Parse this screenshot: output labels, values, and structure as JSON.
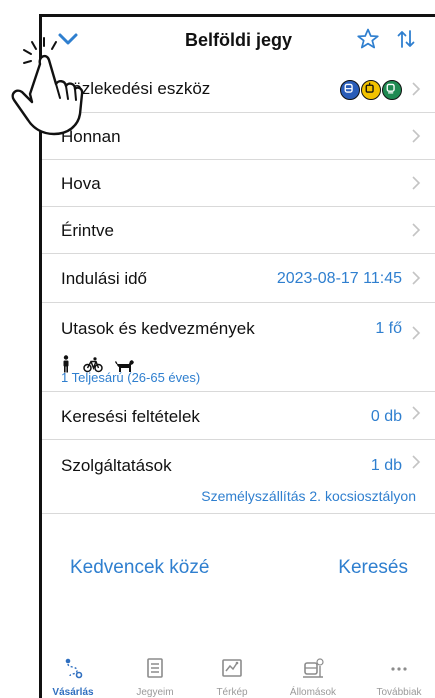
{
  "header": {
    "title": "Belföldi jegy"
  },
  "rows": {
    "transport": {
      "label": "Közlekedési eszköz",
      "icons": [
        "bus-icon",
        "tram-icon",
        "train-icon"
      ]
    },
    "from": {
      "label": "Honnan"
    },
    "to": {
      "label": "Hova"
    },
    "via": {
      "label": "Érintve"
    },
    "departure": {
      "label": "Indulási idő",
      "value": "2023-08-17 11:45"
    },
    "passengers": {
      "label": "Utasok és kedvezmények",
      "value": "1 fő",
      "icons": [
        "person-icon",
        "bicycle-icon",
        "dog-icon"
      ],
      "detail": "1 Teljesárú (26-65 éves)"
    },
    "criteria": {
      "label": "Keresési feltételek",
      "value": "0 db"
    },
    "services": {
      "label": "Szolgáltatások",
      "value": "1 db",
      "detail": "Személyszállítás 2. kocsiosztályon"
    }
  },
  "actions": {
    "favorites": "Kedvencek közé",
    "search": "Keresés"
  },
  "tabs": [
    {
      "label": "Vásárlás",
      "icon": "route-icon",
      "active": true
    },
    {
      "label": "Jegyeim",
      "icon": "ticket-list-icon",
      "active": false
    },
    {
      "label": "Térkép",
      "icon": "map-icon",
      "active": false
    },
    {
      "label": "Állomások",
      "icon": "station-icon",
      "active": false
    },
    {
      "label": "Továbbiak",
      "icon": "more-icon",
      "active": false
    }
  ],
  "colors": {
    "accent": "#2f7fcf",
    "bus": "#2a5db8",
    "tram": "#f2c200",
    "train": "#1f8a52"
  }
}
